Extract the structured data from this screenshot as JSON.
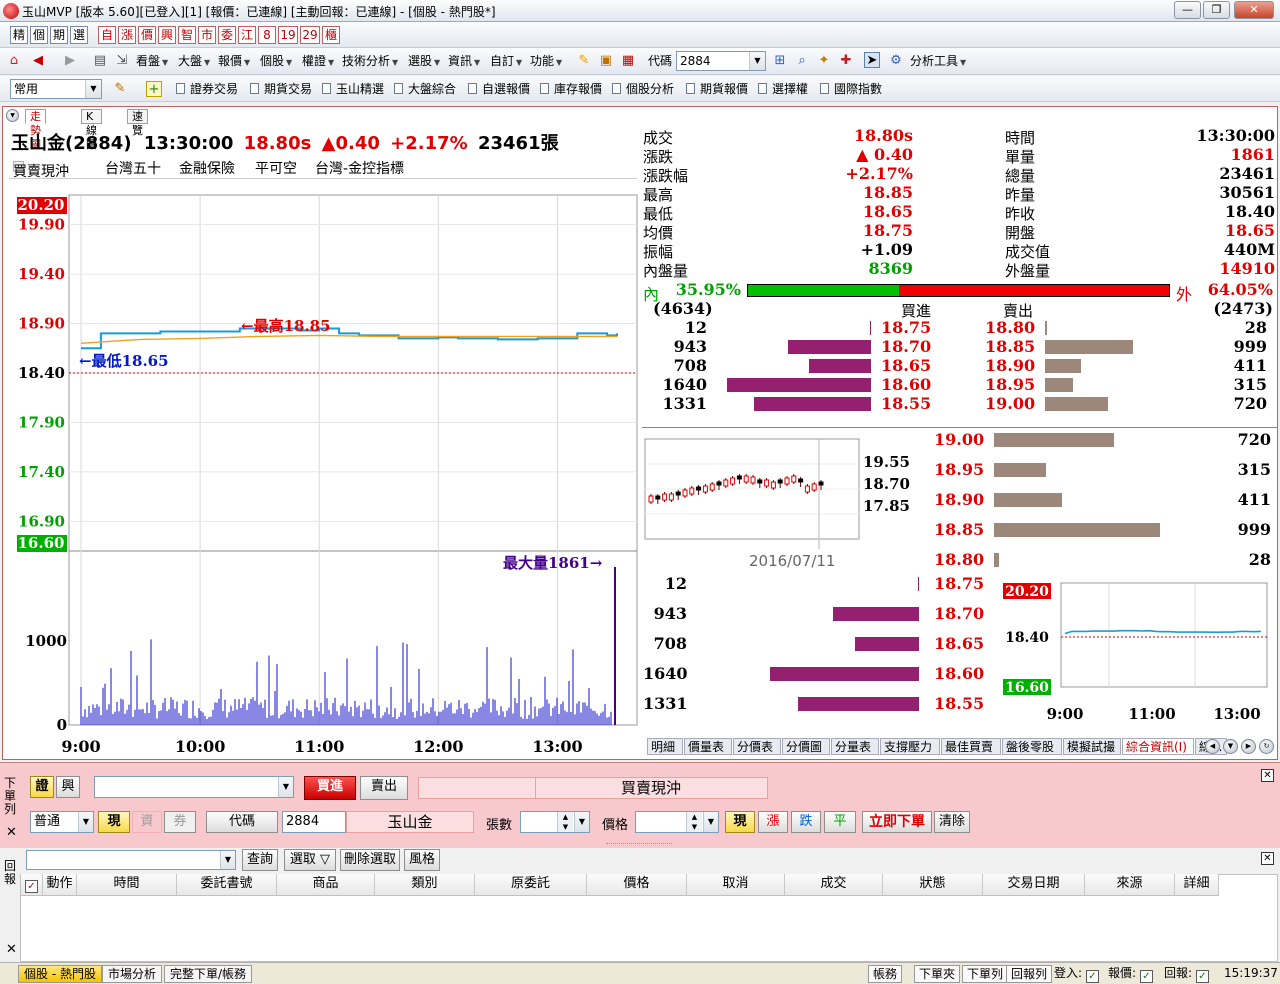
{
  "window": {
    "title": "玉山MVP [版本 5.60][已登入][1] [報價：已連線] [主動回報：已連線] - [個股 - 熱門股*]",
    "minimize": "—",
    "restore": "❐",
    "close": "✕"
  },
  "toolbar1": {
    "buttons": [
      "精",
      "個",
      "期",
      "選",
      "自",
      "漲",
      "價",
      "興",
      "智",
      "市",
      "委",
      "江",
      "8",
      "19",
      "29",
      "櫃"
    ]
  },
  "toolbar2": {
    "menus": [
      "看盤",
      "大盤",
      "報價",
      "個股",
      "權證",
      "技術分析",
      "選股",
      "資訊",
      "自訂",
      "功能"
    ],
    "code_label": "代碼",
    "code_value": "2884",
    "analysis_tools": "分析工具"
  },
  "toolbar3": {
    "combo_value": "常用",
    "links": [
      "證券交易",
      "期貨交易",
      "玉山精選",
      "大盤綜合",
      "自選報價",
      "庫存報價",
      "個股分析",
      "期貨報價",
      "選擇權",
      "國際指數"
    ]
  },
  "chart_tabs": [
    "走勢圖",
    "K線圖",
    "速覽"
  ],
  "header": {
    "name": "玉山金(2884)",
    "time": "13:30:00",
    "price": "18.80s",
    "change": "▲0.40",
    "pct": "+2.17%",
    "volume": "23461張"
  },
  "tags": [
    "買賣現沖",
    "台灣五十",
    "金融保險",
    "平可空",
    "台灣-金控指標"
  ],
  "chart_data": [
    {
      "type": "line",
      "title": "",
      "x_ticks": [
        "9:00",
        "10:00",
        "11:00",
        "12:00",
        "13:00"
      ],
      "price_ticks": [
        "20.20",
        "19.90",
        "19.40",
        "18.90",
        "18.40",
        "17.90",
        "17.40",
        "16.90",
        "16.60"
      ],
      "ylim": [
        16.6,
        20.2
      ],
      "reference": 18.4,
      "annotations": {
        "high": "←最高18.85",
        "low": "←最低18.65",
        "max_volume": "最大量1861→"
      },
      "volume_ticks": [
        "1000",
        "0"
      ],
      "volume_max": 1861,
      "series": [
        {
          "name": "",
          "x": [
            "09:00",
            "09:10",
            "09:20",
            "09:30",
            "09:40",
            "09:50",
            "10:00",
            "10:10",
            "10:20",
            "10:30",
            "10:40",
            "10:50",
            "11:00",
            "11:10",
            "11:20",
            "11:30",
            "11:40",
            "11:50",
            "12:00",
            "12:10",
            "12:20",
            "12:30",
            "12:40",
            "12:50",
            "13:00",
            "13:10",
            "13:20",
            "13:25",
            "13:30"
          ],
          "values": [
            18.65,
            18.8,
            18.8,
            18.8,
            18.82,
            18.82,
            18.82,
            18.82,
            18.85,
            18.85,
            18.85,
            18.83,
            18.85,
            18.8,
            18.78,
            18.78,
            18.75,
            18.75,
            18.76,
            18.75,
            18.75,
            18.74,
            18.74,
            18.75,
            18.75,
            18.8,
            18.8,
            18.78,
            18.8
          ]
        },
        {
          "name": "",
          "x": [
            "09:00",
            "09:30",
            "10:00",
            "10:30",
            "11:00",
            "11:30",
            "12:00",
            "12:30",
            "13:00",
            "13:30"
          ],
          "values": [
            18.7,
            18.74,
            18.75,
            18.77,
            18.78,
            18.77,
            18.77,
            18.77,
            18.77,
            18.77
          ]
        }
      ]
    },
    {
      "type": "candlestick",
      "title": "",
      "date_label": "2016/07/11",
      "y_ticks": [
        "19.55",
        "18.70",
        "17.85"
      ]
    },
    {
      "type": "line",
      "title": "",
      "x_ticks": [
        "9:00",
        "11:00",
        "13:00"
      ],
      "y_ticks": [
        "20.20",
        "18.40",
        "16.60"
      ]
    }
  ],
  "quote": {
    "left": [
      {
        "k": "成交",
        "v": "18.80s",
        "c": "red"
      },
      {
        "k": "漲跌",
        "v": "▲ 0.40",
        "c": "red"
      },
      {
        "k": "漲跌幅",
        "v": "+2.17%",
        "c": "red"
      },
      {
        "k": "最高",
        "v": "18.85",
        "c": "red"
      },
      {
        "k": "最低",
        "v": "18.65",
        "c": "red"
      },
      {
        "k": "均價",
        "v": "18.75",
        "c": "red"
      },
      {
        "k": "振幅",
        "v": "+1.09",
        "c": "black"
      },
      {
        "k": "內盤量",
        "v": "8369",
        "c": "green"
      }
    ],
    "right": [
      {
        "k": "時間",
        "v": "13:30:00",
        "c": "black"
      },
      {
        "k": "單量",
        "v": "1861",
        "c": "red"
      },
      {
        "k": "總量",
        "v": "23461",
        "c": "black"
      },
      {
        "k": "昨量",
        "v": "30561",
        "c": "black"
      },
      {
        "k": "昨收",
        "v": "18.40",
        "c": "black"
      },
      {
        "k": "開盤",
        "v": "18.65",
        "c": "red"
      },
      {
        "k": "成交值",
        "v": "440M",
        "c": "black"
      },
      {
        "k": "外盤量",
        "v": "14910",
        "c": "red"
      }
    ],
    "inner_label": "內",
    "inner_pct": "35.95%",
    "outer_label": "外",
    "outer_pct": "64.05%",
    "inner_fraction": 0.3595
  },
  "orderbook": {
    "total_bid": "(4634)",
    "total_ask": "(2473)",
    "bid_label": "買進",
    "ask_label": "賣出",
    "rows": [
      {
        "bid_vol": "12",
        "bid": "18.75",
        "ask": "18.80",
        "ask_vol": "28"
      },
      {
        "bid_vol": "943",
        "bid": "18.70",
        "ask": "18.85",
        "ask_vol": "999"
      },
      {
        "bid_vol": "708",
        "bid": "18.65",
        "ask": "18.90",
        "ask_vol": "411"
      },
      {
        "bid_vol": "1640",
        "bid": "18.60",
        "ask": "18.95",
        "ask_vol": "315"
      },
      {
        "bid_vol": "1331",
        "bid": "18.55",
        "ask": "19.00",
        "ask_vol": "720"
      }
    ],
    "ladder_ask": [
      {
        "p": "19.00",
        "v": "720"
      },
      {
        "p": "18.95",
        "v": "315"
      },
      {
        "p": "18.90",
        "v": "411"
      },
      {
        "p": "18.85",
        "v": "999"
      },
      {
        "p": "18.80",
        "v": "28"
      }
    ],
    "ladder_bid": [
      {
        "p": "18.75",
        "v": "12"
      },
      {
        "p": "18.70",
        "v": "943"
      },
      {
        "p": "18.65",
        "v": "708"
      },
      {
        "p": "18.60",
        "v": "1640"
      },
      {
        "p": "18.55",
        "v": "1331"
      }
    ]
  },
  "bottom_tabs": [
    "明細",
    "價量表",
    "分價表",
    "分價圖",
    "分量表",
    "支撐壓力",
    "最佳買賣",
    "盤後零股",
    "模擬試撮",
    "綜合資訊(I)",
    "綜..."
  ],
  "order": {
    "side_label": "下單列",
    "mode_a": "證",
    "mode_b": "興",
    "buy": "買進",
    "sell": "賣出",
    "caption": "買賣現沖",
    "type_value": "普通",
    "cash": "現",
    "margin": "資",
    "short": "券",
    "code_btn": "代碼",
    "code_value": "2884",
    "stock_name": "玉山金",
    "qty_label": "張數",
    "price_label": "價格",
    "price_cash": "現",
    "up": "漲",
    "down": "跌",
    "flat": "平",
    "submit": "立即下單",
    "clear": "清除"
  },
  "report": {
    "side_label": "回報",
    "query": "查詢",
    "select": "選取 ▽",
    "deselect": "刪除選取",
    "style": "風格",
    "columns": [
      "動作",
      "時間",
      "委託書號",
      "商品",
      "類別",
      "原委託",
      "價格",
      "取消",
      "成交",
      "狀態",
      "交易日期",
      "來源",
      "詳細"
    ]
  },
  "status": {
    "tabs": [
      "個股 - 熱門股",
      "市場分析",
      "完整下單/帳務"
    ],
    "buttons": [
      "帳務",
      "下單夾",
      "下單列",
      "回報列"
    ],
    "login": "登入:",
    "quote": "報價:",
    "report": "回報:",
    "clock": "15:19:37"
  }
}
